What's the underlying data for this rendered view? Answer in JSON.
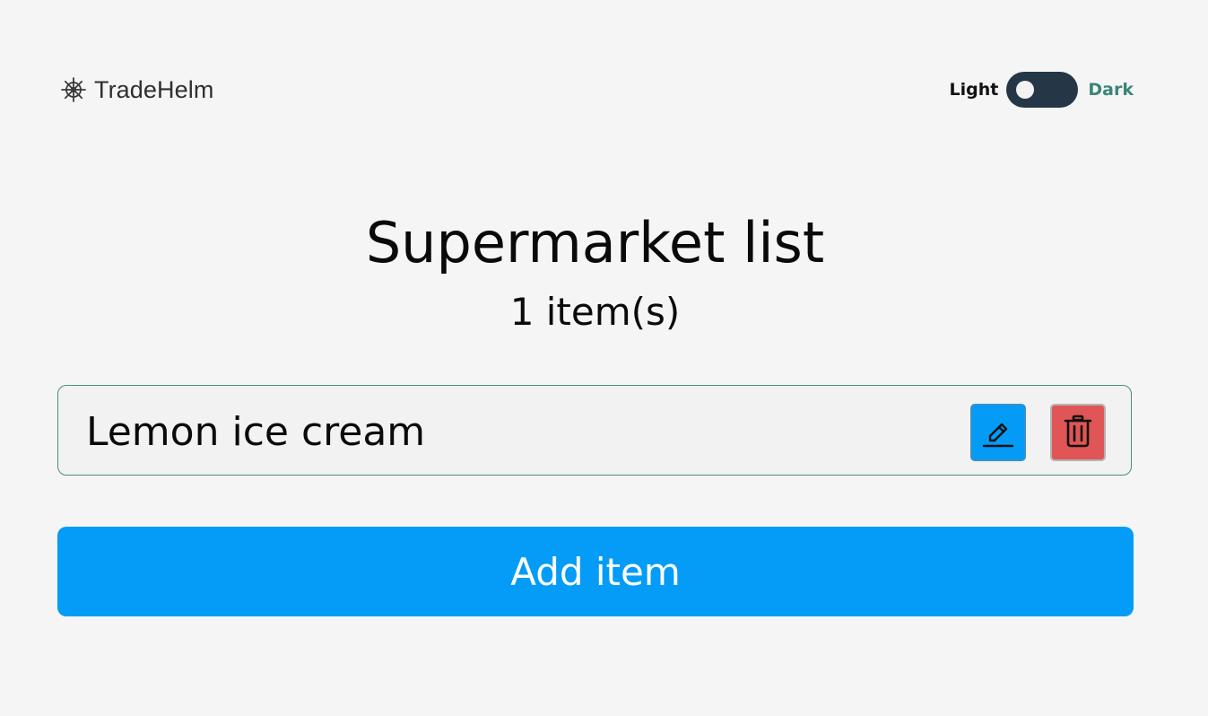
{
  "header": {
    "brand_name": "TradeHelm",
    "logo_icon": "ship-wheel-icon",
    "theme_toggle": {
      "light_label": "Light",
      "dark_label": "Dark",
      "state": "light"
    }
  },
  "main": {
    "title": "Supermarket list",
    "item_count": "1 item(s)",
    "items": [
      {
        "name": "Lemon ice cream",
        "edit_icon": "pencil-icon",
        "delete_icon": "trash-icon"
      }
    ],
    "add_button_label": "Add item"
  },
  "colors": {
    "background": "#f5f5f5",
    "primary": "#049cf6",
    "danger": "#e05555",
    "toggle_track": "#253647",
    "accent_text": "#3b8578",
    "item_border": "#4c8c83"
  }
}
